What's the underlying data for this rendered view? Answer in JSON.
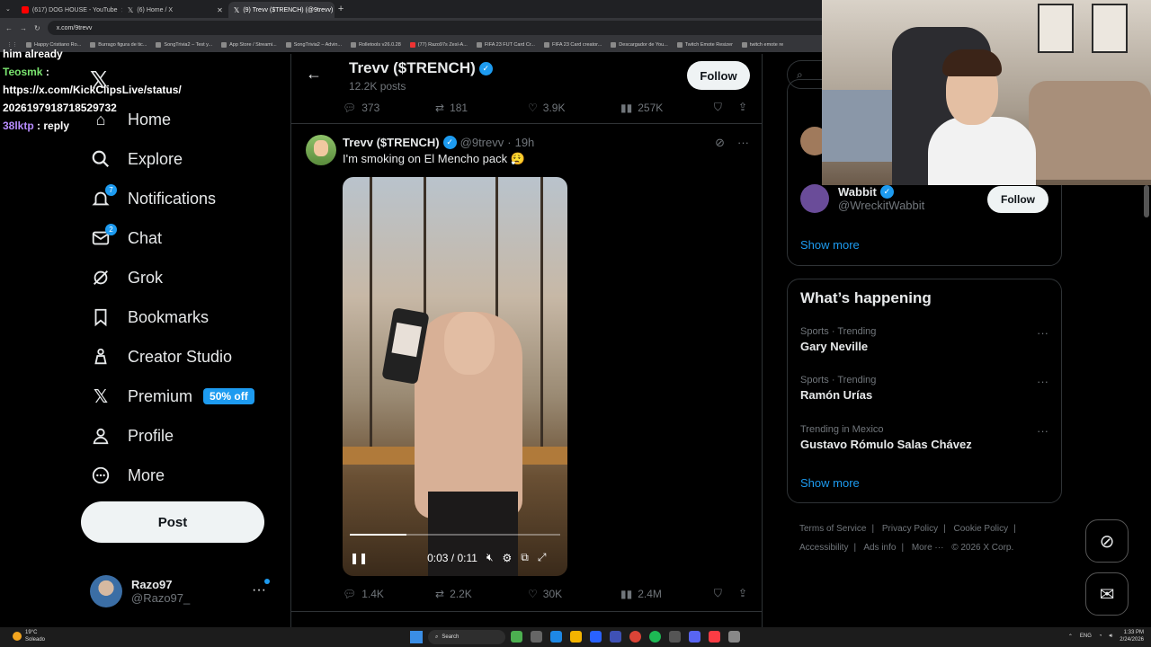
{
  "browser": {
    "tabs": [
      {
        "title": "(617) DOG HOUSE - YouTube",
        "color": "#ff0000"
      },
      {
        "title": "(6) Home / X",
        "color": "#111111"
      },
      {
        "title": "(9) Trevv ($TRENCH) (@9trevv)",
        "color": "#111111"
      }
    ],
    "url": "x.com/9trevv",
    "bookmarks": [
      "Happy Cristiano Ro...",
      "Burrago figura de tic...",
      "SongTrivia2 – Test y...",
      "App Store / Streami...",
      "SongTrivia2 – Advin...",
      "Rolletools v26.0.28",
      "(77) Razo97s Zesl-A...",
      "FIFA 23 FUT Card Cr...",
      "FIFA 23 Card creator...",
      "Descargador de You...",
      "Twitch Emote Resizer",
      "twitch emote re"
    ]
  },
  "chat": {
    "lines": [
      {
        "user": "",
        "text": "him already",
        "color": "#ffffff"
      },
      {
        "user": "Teosmk",
        "text": ":",
        "color": "#7ae56f"
      },
      {
        "user": "",
        "text": "https://x.com/KickClipsLive/status/",
        "color": "#ffffff"
      },
      {
        "user": "",
        "text": "2026197918718529732",
        "color": "#ffffff"
      },
      {
        "user": "38lktp",
        "text": ": reply",
        "color": "#b88cff"
      }
    ]
  },
  "nav": {
    "home": "Home",
    "explore": "Explore",
    "notifications": "Notifications",
    "notifications_badge": "7",
    "chat": "Chat",
    "chat_badge": "2",
    "grok": "Grok",
    "bookmarks": "Bookmarks",
    "creator_studio": "Creator Studio",
    "premium": "Premium",
    "premium_promo": "50% off",
    "profile": "Profile",
    "more": "More",
    "post": "Post"
  },
  "account": {
    "name": "Razo97",
    "handle": "@Razo97_"
  },
  "profile_header": {
    "name": "Trevv ($TRENCH)",
    "posts": "12.2K posts",
    "follow": "Follow"
  },
  "prev_tweet_stats": {
    "replies": "373",
    "reposts": "181",
    "likes": "3.9K",
    "views": "257K"
  },
  "tweet": {
    "name": "Trevv ($TRENCH)",
    "handle": "@9trevv",
    "time": "19h",
    "text": "I'm smoking on El Mencho pack 😮‍💨",
    "video_time": "0:03 / 0:11",
    "video_progress": 0.27,
    "stats": {
      "replies": "1.4K",
      "reposts": "2.2K",
      "likes": "30K",
      "views": "2.4M"
    }
  },
  "who_to_follow": {
    "name": "Wabbit",
    "handle": "@WreckitWabbit",
    "follow": "Follow",
    "show_more": "Show more"
  },
  "happening": {
    "title": "What’s happening",
    "trends": [
      {
        "context": "Sports · Trending",
        "title": "Gary Neville"
      },
      {
        "context": "Sports · Trending",
        "title": "Ramón Urías"
      },
      {
        "context": "Trending in Mexico",
        "title": "Gustavo Rómulo Salas Chávez"
      }
    ],
    "show_more": "Show more"
  },
  "footer": {
    "links": [
      "Terms of Service",
      "Privacy Policy",
      "Cookie Policy",
      "Accessibility",
      "Ads info",
      "More ···"
    ],
    "copyright": "© 2026 X Corp."
  },
  "taskbar": {
    "temp": "19°C",
    "weather": "Soleado",
    "search": "Search",
    "lang": "ENG",
    "time": "1:33 PM",
    "date": "2/24/2026"
  },
  "colors": {
    "accent": "#1d9bf0",
    "bg": "#000000",
    "muted": "#71767b"
  }
}
